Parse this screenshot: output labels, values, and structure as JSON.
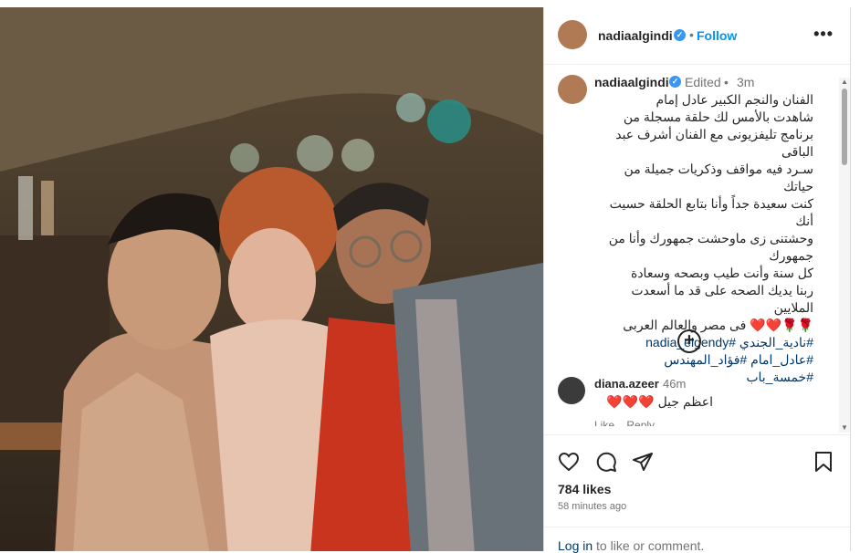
{
  "post": {
    "username": "nadiaalgindi",
    "follow_label": "Follow",
    "more_label": "•••",
    "separator": "•"
  },
  "caption": {
    "username": "nadiaalgindi",
    "edited_label": "Edited",
    "separator": "•",
    "time": "3m",
    "lines": [
      "الفنان والنجم الكبير عادل إمام",
      "شاهدت بالأمس لك حلقة مسجلة من",
      "برنامج تليفزيونى مع الفنان أشرف عبد",
      "الباقى",
      "سـرد فيه مواقف وذكريات جميلة من حياتك",
      "كنت سعيدة جداً وأنا بتابع الحلقة حسيت أنك",
      "وحشتنى زى ماوحشت جمهورك وأنا من",
      "جمهورك",
      "كل سنة وأنت طيب وبصحه وسعادة",
      "ربنا يديك الصحه على قد ما أسعدت الملايين",
      "فى مصر والعالم العربى"
    ],
    "emoji_line": "🌹🌹❤️❤️",
    "hashtags_line1": "#نادية_الجندي #nadia_elgendy",
    "hashtags_line2": "#عادل_امام #فؤاد_المهندس #خمسة_باب"
  },
  "load_more_label": "+",
  "comment": {
    "username": "diana.azeer",
    "time": "46m",
    "text": "اعظم جيل ❤️❤️❤️",
    "like_label": "Like",
    "reply_label": "Reply"
  },
  "actions": {
    "likes": "784 likes",
    "time_ago": "58 minutes ago"
  },
  "login": {
    "link": "Log in",
    "rest": " to like or comment."
  },
  "icons": {
    "like": "heart-icon",
    "comment": "comment-icon",
    "share": "share-icon",
    "save": "bookmark-icon",
    "verified": "verified-badge-icon",
    "more": "more-options-icon",
    "load_more": "plus-circle-icon"
  },
  "colors": {
    "link": "#0095f6",
    "hashtag": "#00376b",
    "verified": "#3897f0",
    "muted": "#737373"
  }
}
